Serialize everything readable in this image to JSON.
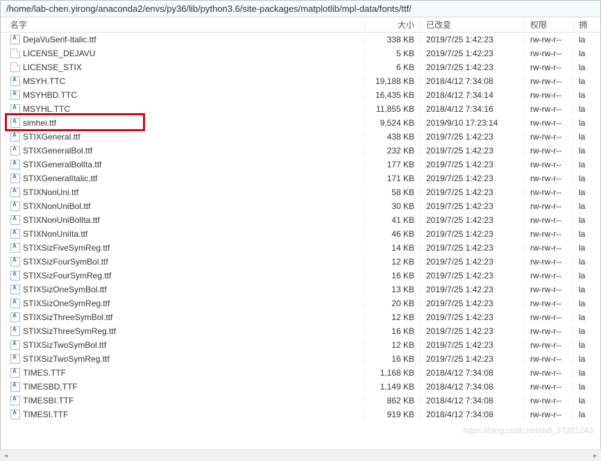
{
  "path": "/home/lab-chen.yirong/anaconda2/envs/py36/lib/python3.6/site-packages/matplotlib/mpl-data/fonts/ttf/",
  "columns": {
    "name": "名字",
    "size": "大小",
    "modified": "已改变",
    "perm": "权限",
    "owner": "拥"
  },
  "owner_text": "la",
  "watermark": "https://blog.csdn.net/m0_37201243",
  "files": [
    {
      "name": "DejaVuSerif-Italic.ttf",
      "size": "338 KB",
      "modified": "2019/7/25 1:42:23",
      "perm": "rw-rw-r--",
      "icon": "font"
    },
    {
      "name": "LICENSE_DEJAVU",
      "size": "5 KB",
      "modified": "2019/7/25 1:42:23",
      "perm": "rw-rw-r--",
      "icon": "doc"
    },
    {
      "name": "LICENSE_STIX",
      "size": "6 KB",
      "modified": "2019/7/25 1:42:23",
      "perm": "rw-rw-r--",
      "icon": "doc"
    },
    {
      "name": "MSYH.TTC",
      "size": "19,188 KB",
      "modified": "2018/4/12 7:34:08",
      "perm": "rw-rw-r--",
      "icon": "font"
    },
    {
      "name": "MSYHBD.TTC",
      "size": "16,435 KB",
      "modified": "2018/4/12 7:34:14",
      "perm": "rw-rw-r--",
      "icon": "font"
    },
    {
      "name": "MSYHL.TTC",
      "size": "11,855 KB",
      "modified": "2018/4/12 7:34:16",
      "perm": "rw-rw-r--",
      "icon": "font"
    },
    {
      "name": "simhei.ttf",
      "size": "9,524 KB",
      "modified": "2019/9/10 17:23:14",
      "perm": "rw-rw-r--",
      "icon": "font"
    },
    {
      "name": "STIXGeneral.ttf",
      "size": "438 KB",
      "modified": "2019/7/25 1:42:23",
      "perm": "rw-rw-r--",
      "icon": "font"
    },
    {
      "name": "STIXGeneralBol.ttf",
      "size": "232 KB",
      "modified": "2019/7/25 1:42:23",
      "perm": "rw-rw-r--",
      "icon": "font"
    },
    {
      "name": "STIXGeneralBolIta.ttf",
      "size": "177 KB",
      "modified": "2019/7/25 1:42:23",
      "perm": "rw-rw-r--",
      "icon": "font"
    },
    {
      "name": "STIXGeneralItalic.ttf",
      "size": "171 KB",
      "modified": "2019/7/25 1:42:23",
      "perm": "rw-rw-r--",
      "icon": "font"
    },
    {
      "name": "STIXNonUni.ttf",
      "size": "58 KB",
      "modified": "2019/7/25 1:42:23",
      "perm": "rw-rw-r--",
      "icon": "font"
    },
    {
      "name": "STIXNonUniBol.ttf",
      "size": "30 KB",
      "modified": "2019/7/25 1:42:23",
      "perm": "rw-rw-r--",
      "icon": "font"
    },
    {
      "name": "STIXNonUniBolIta.ttf",
      "size": "41 KB",
      "modified": "2019/7/25 1:42:23",
      "perm": "rw-rw-r--",
      "icon": "font"
    },
    {
      "name": "STIXNonUniIta.ttf",
      "size": "46 KB",
      "modified": "2019/7/25 1:42:23",
      "perm": "rw-rw-r--",
      "icon": "font"
    },
    {
      "name": "STIXSizFiveSymReg.ttf",
      "size": "14 KB",
      "modified": "2019/7/25 1:42:23",
      "perm": "rw-rw-r--",
      "icon": "font"
    },
    {
      "name": "STIXSizFourSymBol.ttf",
      "size": "12 KB",
      "modified": "2019/7/25 1:42:23",
      "perm": "rw-rw-r--",
      "icon": "font"
    },
    {
      "name": "STIXSizFourSymReg.ttf",
      "size": "16 KB",
      "modified": "2019/7/25 1:42:23",
      "perm": "rw-rw-r--",
      "icon": "font"
    },
    {
      "name": "STIXSizOneSymBol.ttf",
      "size": "13 KB",
      "modified": "2019/7/25 1:42:23",
      "perm": "rw-rw-r--",
      "icon": "font"
    },
    {
      "name": "STIXSizOneSymReg.ttf",
      "size": "20 KB",
      "modified": "2019/7/25 1:42:23",
      "perm": "rw-rw-r--",
      "icon": "font"
    },
    {
      "name": "STIXSizThreeSymBol.ttf",
      "size": "12 KB",
      "modified": "2019/7/25 1:42:23",
      "perm": "rw-rw-r--",
      "icon": "font"
    },
    {
      "name": "STIXSizThreeSymReg.ttf",
      "size": "16 KB",
      "modified": "2019/7/25 1:42:23",
      "perm": "rw-rw-r--",
      "icon": "font"
    },
    {
      "name": "STIXSizTwoSymBol.ttf",
      "size": "12 KB",
      "modified": "2019/7/25 1:42:23",
      "perm": "rw-rw-r--",
      "icon": "font"
    },
    {
      "name": "STIXSizTwoSymReg.ttf",
      "size": "16 KB",
      "modified": "2019/7/25 1:42:23",
      "perm": "rw-rw-r--",
      "icon": "font"
    },
    {
      "name": "TIMES.TTF",
      "size": "1,168 KB",
      "modified": "2018/4/12 7:34:08",
      "perm": "rw-rw-r--",
      "icon": "font"
    },
    {
      "name": "TIMESBD.TTF",
      "size": "1,149 KB",
      "modified": "2018/4/12 7:34:08",
      "perm": "rw-rw-r--",
      "icon": "font"
    },
    {
      "name": "TIMESBI.TTF",
      "size": "862 KB",
      "modified": "2018/4/12 7:34:08",
      "perm": "rw-rw-r--",
      "icon": "font"
    },
    {
      "name": "TIMESI.TTF",
      "size": "919 KB",
      "modified": "2018/4/12 7:34:08",
      "perm": "rw-rw-r--",
      "icon": "font"
    }
  ]
}
